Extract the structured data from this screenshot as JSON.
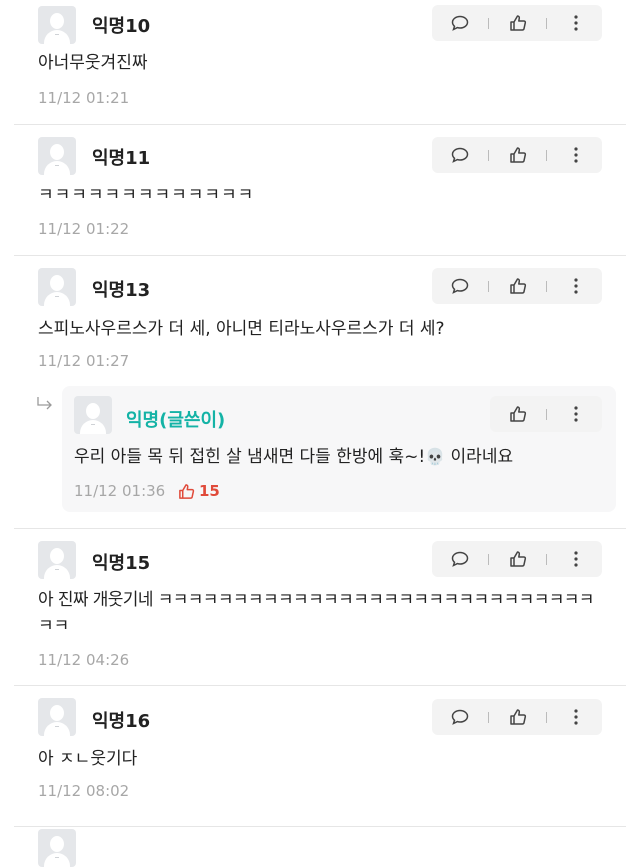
{
  "comments": [
    {
      "name": "익명10",
      "text": "아너무웃겨진짜",
      "time": "11/12 01:21"
    },
    {
      "name": "익명11",
      "text": "ㅋㅋㅋㅋㅋㅋㅋㅋㅋㅋㅋㅋㅋ",
      "time": "11/12 01:22"
    },
    {
      "name": "익명13",
      "text": "스피노사우르스가 더 세, 아니면 티라노사우르스가 더 세?",
      "time": "11/12 01:27"
    },
    {
      "name": "익명15",
      "text_line1": "아 진짜 개웃기네 ㅋㅋㅋㅋㅋㅋㅋㅋㅋㅋㅋㅋㅋㅋㅋㅋㅋㅋㅋㅋㅋㅋㅋㅋㅋㅋㅋㅋㅋ",
      "text_line2": "ㅋㅋ",
      "time": "11/12 04:26"
    },
    {
      "name": "익명16",
      "text": "아 ㅈㄴ웃기다",
      "time": "11/12 08:02"
    }
  ],
  "reply": {
    "name": "익명(글쓴이)",
    "text_before": "우리 아들 목 뒤 접힌 살 냄새면 다들 한방에 훅~!",
    "emoji": "💀",
    "text_after": " 이라네요",
    "time": "11/12 01:36",
    "likes": "15"
  },
  "icons": {
    "comment": "speech-bubble-icon",
    "like": "thumbs-up-icon",
    "more": "vertical-dots-icon",
    "reply": "reply-arrow-icon"
  },
  "colors": {
    "author": "#14b3a6",
    "like_active": "#e04a3a",
    "timestamp": "#a7a7a7"
  }
}
